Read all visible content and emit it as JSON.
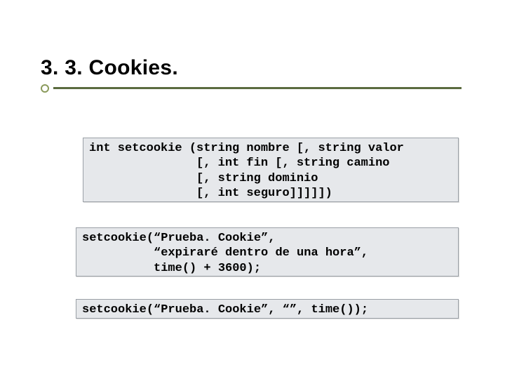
{
  "title": "3. 3. Cookies.",
  "code1": "int setcookie (string nombre [, string valor\n               [, int fin [, string camino\n               [, string dominio\n               [, int seguro]]]]])",
  "code2": "setcookie(“Prueba. Cookie”,\n          “expiraré dentro de una hora”,\n          time() + 3600);",
  "code3": "setcookie(“Prueba. Cookie”, “”, time());"
}
